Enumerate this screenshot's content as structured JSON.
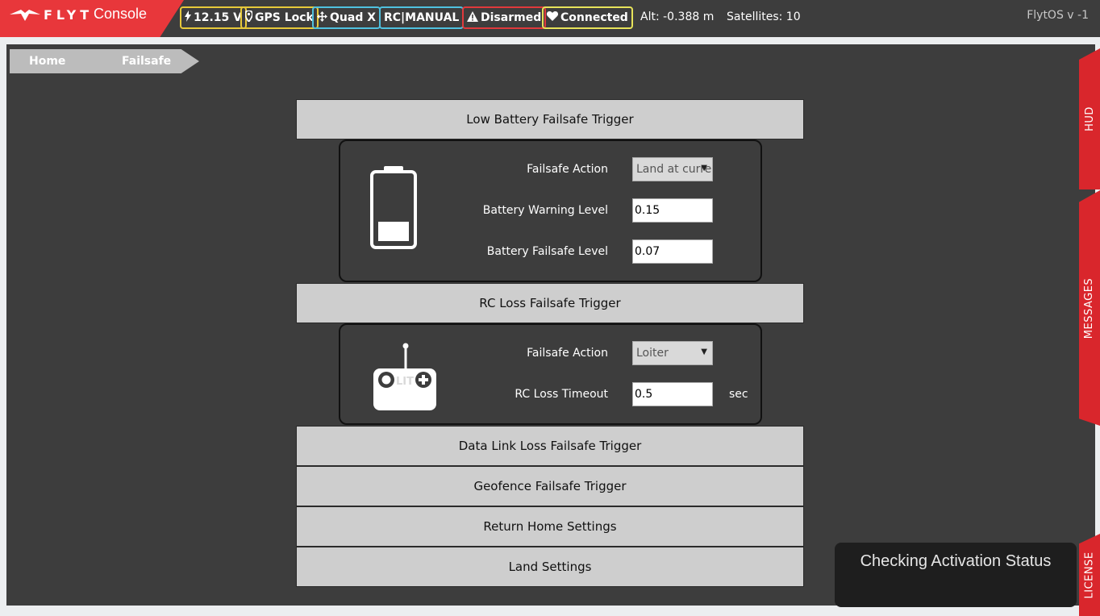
{
  "header": {
    "logo_text": "FLYT",
    "logo_sub": "Console",
    "badges": [
      {
        "icon": "bolt-icon",
        "label": "12.15 V",
        "color": "#e7c93a"
      },
      {
        "icon": "map-marker-icon",
        "label": "GPS Lock",
        "color": "#e7c93a"
      },
      {
        "icon": "move-arrows-icon",
        "label": "Quad X",
        "color": "#4fc1df"
      },
      {
        "icon": "",
        "label": "RC|MANUAL",
        "color": "#4fc1df"
      },
      {
        "icon": "warning-icon",
        "label": "Disarmed",
        "color": "#e0393c"
      },
      {
        "icon": "heart-icon",
        "label": "Connected",
        "color": "#e7e35a"
      }
    ],
    "altitude": "Alt: -0.388 m",
    "satellites": "Satellites: 10",
    "version": "FlytOS v -1"
  },
  "breadcrumb": {
    "home": "Home",
    "current": "Failsafe"
  },
  "sections": {
    "low_battery": {
      "title": "Low Battery Failsafe Trigger",
      "action_label": "Failsafe Action",
      "action_value": "Land at current",
      "warning_label": "Battery Warning Level",
      "warning_value": "0.15",
      "failsafe_label": "Battery Failsafe Level",
      "failsafe_value": "0.07"
    },
    "rc_loss": {
      "title": "RC Loss Failsafe Trigger",
      "action_label": "Failsafe Action",
      "action_value": "Loiter",
      "timeout_label": "RC Loss Timeout",
      "timeout_value": "0.5",
      "timeout_unit": "sec"
    },
    "data_link": {
      "title": "Data Link Loss Failsafe Trigger"
    },
    "geofence": {
      "title": "Geofence Failsafe Trigger"
    },
    "return_home": {
      "title": "Return Home Settings"
    },
    "land": {
      "title": "Land Settings"
    }
  },
  "side_tabs": {
    "hud": "HUD",
    "messages": "MESSAGES",
    "license": "LICENSE"
  },
  "toast": {
    "message": "Checking Activation Status"
  }
}
